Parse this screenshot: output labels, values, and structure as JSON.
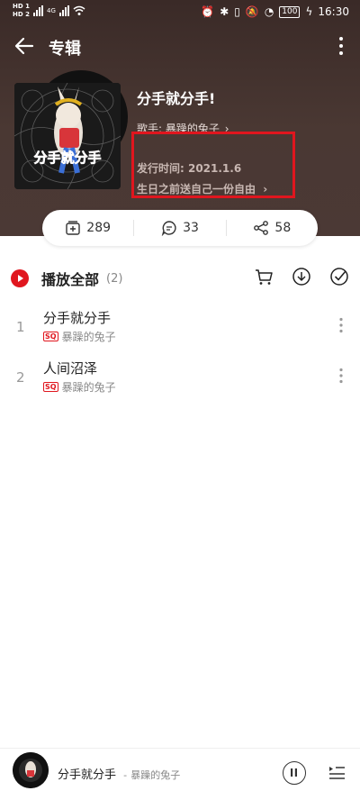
{
  "status_bar": {
    "hd1": "HD 1",
    "hd2": "HD 2",
    "net": "4G",
    "battery": "100",
    "time": "16:30"
  },
  "header": {
    "title": "专辑"
  },
  "album": {
    "name": "分手就分手!",
    "artist_prefix": "歌手:",
    "artist": "暴躁的兔子",
    "release_label": "发行时间: 2021.1.6",
    "description": "生日之前送自己一份自由"
  },
  "stats": {
    "collect": "289",
    "comments": "33",
    "shares": "58"
  },
  "playlist": {
    "play_all_label": "播放全部",
    "count": "(2)"
  },
  "songs": [
    {
      "index": "1",
      "title": "分手就分手",
      "quality": "SQ",
      "artist": "暴躁的兔子"
    },
    {
      "index": "2",
      "title": "人间沼泽",
      "quality": "SQ",
      "artist": "暴躁的兔子"
    }
  ],
  "mini_player": {
    "title": "分手就分手",
    "separator": "-",
    "artist": "暴躁的兔子"
  },
  "colors": {
    "accent": "#e0161e",
    "header_bg": "#3a2a27"
  }
}
